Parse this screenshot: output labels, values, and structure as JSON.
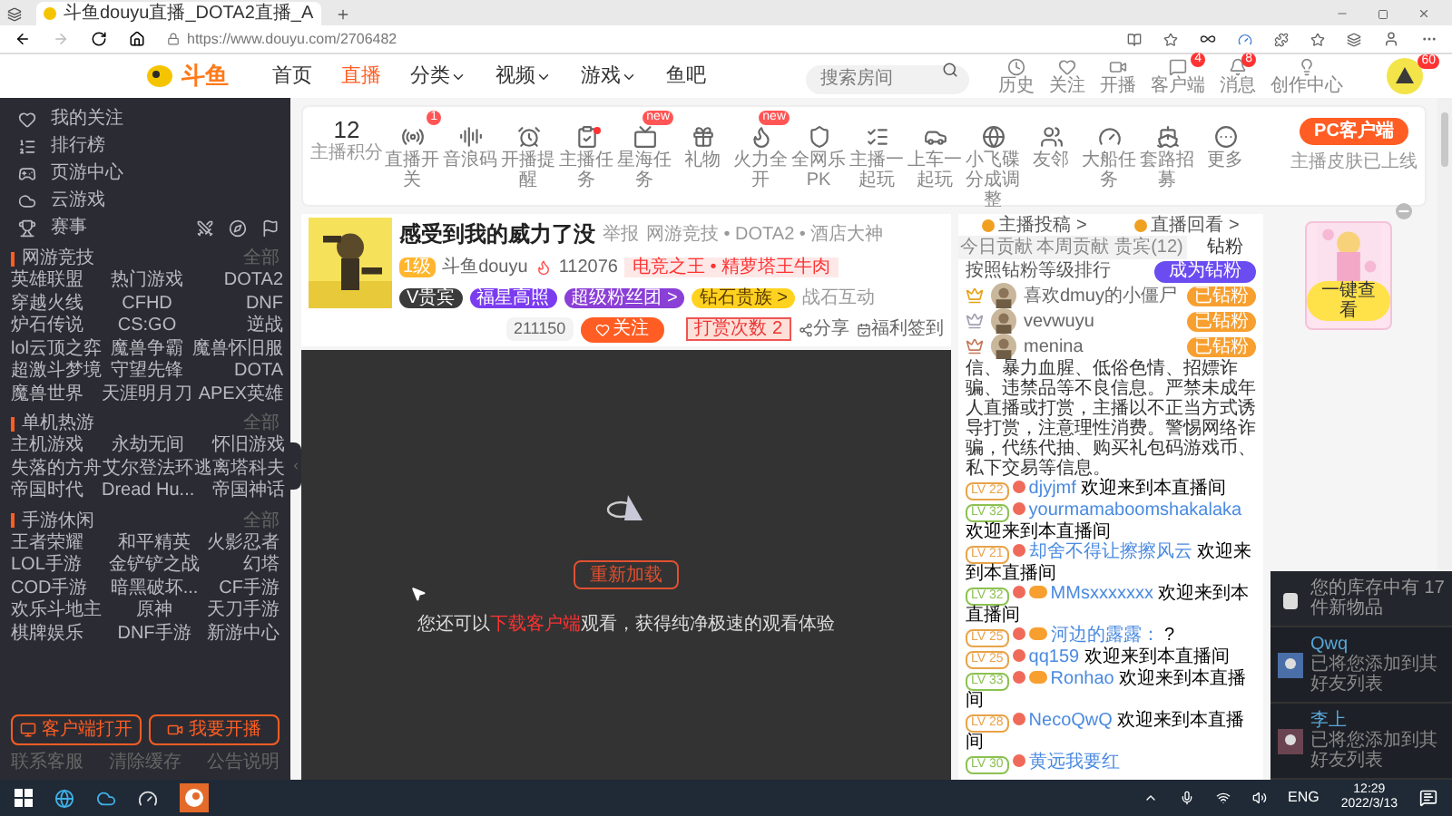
{
  "browser": {
    "tab_title": "斗鱼douyu直播_DOTA2直播_A",
    "url": "https://www.douyu.com/2706482"
  },
  "header": {
    "logo": "斗鱼",
    "nav": [
      {
        "label": "首页",
        "selected": false,
        "dropdown": false
      },
      {
        "label": "直播",
        "selected": true,
        "dropdown": false
      },
      {
        "label": "分类",
        "selected": false,
        "dropdown": true
      },
      {
        "label": "视频",
        "selected": false,
        "dropdown": true
      },
      {
        "label": "游戏",
        "selected": false,
        "dropdown": true
      },
      {
        "label": "鱼吧",
        "selected": false,
        "dropdown": false
      }
    ],
    "search": {
      "placeholder": "搜索房间"
    },
    "actions": [
      {
        "label": "历史"
      },
      {
        "label": "关注"
      },
      {
        "label": "开播"
      },
      {
        "label": "客户端",
        "badge": "4"
      },
      {
        "label": "消息",
        "badge": "8"
      },
      {
        "label": "创作中心"
      }
    ],
    "avatar_badge": "60"
  },
  "sidebar": {
    "items": [
      {
        "label": "我的关注"
      },
      {
        "label": "排行榜"
      },
      {
        "label": "页游中心"
      },
      {
        "label": "云游戏"
      }
    ],
    "events_label": "赛事",
    "sections": [
      {
        "title": "网游竞技",
        "more": "全部",
        "games": [
          "英雄联盟",
          "热门游戏",
          "DOTA2",
          "穿越火线",
          "CFHD",
          "DNF",
          "炉石传说",
          "CS:GO",
          "逆战",
          "lol云顶之弈",
          "魔兽争霸",
          "魔兽怀旧服",
          "超激斗梦境",
          "守望先锋",
          "DOTA",
          "魔兽世界",
          "天涯明月刀",
          "APEX英雄"
        ]
      },
      {
        "title": "单机热游",
        "more": "全部",
        "games": [
          "主机游戏",
          "永劫无间",
          "怀旧游戏",
          "失落的方舟",
          "艾尔登法环",
          "逃离塔科夫",
          "帝国时代",
          "Dread Hu...",
          "帝国神话"
        ]
      },
      {
        "title": "手游休闲",
        "more": "全部",
        "games": [
          "王者荣耀",
          "和平精英",
          "火影忍者",
          "LOL手游",
          "金铲铲之战",
          "幻塔",
          "COD手游",
          "暗黑破坏...",
          "CF手游",
          "欢乐斗地主",
          "原神",
          "天刀手游",
          "棋牌娱乐",
          "DNF手游",
          "新游中心"
        ]
      }
    ],
    "buttons": [
      "客户端打开",
      "我要开播"
    ],
    "footer": [
      "联系客服",
      "清除缓存",
      "公告说明"
    ]
  },
  "toolbar": {
    "score": "12",
    "score_label": "主播积分",
    "items": [
      {
        "label": "直播开关",
        "badge": "1",
        "dot": false
      },
      {
        "label": "音浪码",
        "dot": false
      },
      {
        "label": "开播提醒",
        "dot": false
      },
      {
        "label": "主播任务",
        "dot": true
      },
      {
        "label": "星海任务",
        "badge": "new",
        "dot": false
      },
      {
        "label": "礼物",
        "dot": false
      },
      {
        "label": "火力全开",
        "badge": "new",
        "dot": false
      },
      {
        "label": "全网乐PK",
        "dot": false
      },
      {
        "label": "主播一起玩",
        "dot": false
      },
      {
        "label": "上车一起玩",
        "dot": false
      },
      {
        "label": "小飞碟分成调整",
        "dot": false
      },
      {
        "label": "友邻",
        "dot": false
      },
      {
        "label": "大船任务",
        "dot": false
      },
      {
        "label": "套路招募",
        "dot": false
      },
      {
        "label": "更多",
        "dot": false
      }
    ],
    "pc_button": "PC客户端",
    "pc_note": "主播皮肤已上线"
  },
  "room": {
    "title": "感受到我的威力了没",
    "report": "举报",
    "category": "网游竞技 • DOTA2 • 酒店大神",
    "level": "1级",
    "anchor": "斗鱼douyu",
    "heat": "112076",
    "honor": "电竞之王 • 精萝塔王牛肉",
    "group": "战石互动",
    "tags": [
      {
        "label": "V贵宾",
        "kind": "dark"
      },
      {
        "label": "福星高照",
        "kind": "purple"
      },
      {
        "label": "超级粉丝团 >",
        "kind": "violet"
      },
      {
        "label": "钻石贵族 >",
        "kind": "yellow"
      }
    ],
    "followers": "211150",
    "follow": "关注",
    "reward": "打赏次数",
    "reward_count": "2",
    "share": "分享",
    "sign": "福利签到"
  },
  "player": {
    "reload": "重新加载",
    "tip": "您还可以**下载客户端**观看，获得纯净极速的观看体验"
  },
  "panel": {
    "links": [
      "主播投稿 >",
      "直播回看 >"
    ],
    "tabs": [
      {
        "label": "今日贡献",
        "selected": false
      },
      {
        "label": "本周贡献",
        "selected": false
      },
      {
        "label": "贵宾(12)",
        "selected": false
      },
      {
        "label": "钻粉",
        "selected": true
      }
    ],
    "rank_title": "按照钻粉等级排行",
    "rank_button": "成为钻粉",
    "ranks": [
      {
        "name": "喜欢dmuy的小僵尸",
        "badge": "已钻粉",
        "color": "#e6a317"
      },
      {
        "name": "vevwuyu",
        "badge": "已钻粉",
        "color": "#a0a0b0"
      },
      {
        "name": "menina",
        "badge": "已钻粉",
        "color": "#c47a5a"
      }
    ],
    "notice": "信、暴力血腥、低俗色情、招嫖诈骗、违禁品等不良信息。严禁未成年人直播或打赏，主播以不正当方式诱导打赏，注意理性消费。警惕网络诈骗，代练代抽、购买礼包码游戏币、私下交易等信息。",
    "chat": [
      {
        "level": "LV 22",
        "color": "#e8a34a",
        "medal": false,
        "name": "djyjmf",
        "text": "欢迎来到本直播间"
      },
      {
        "level": "LV 32",
        "color": "#8cc152",
        "medal": false,
        "name": "yourmamaboomshakalaka",
        "text": "欢迎来到本直播间"
      },
      {
        "level": "LV 21",
        "color": "#e8a34a",
        "medal": false,
        "name": "却舍不得让擦擦风云",
        "text": "欢迎来到本直播间"
      },
      {
        "level": "LV 32",
        "color": "#8cc152",
        "medal": true,
        "name": "MMsxxxxxxx",
        "text": "欢迎来到本直播间"
      },
      {
        "level": "LV 25",
        "color": "#e8a34a",
        "medal": true,
        "name": "河边的露露：",
        "text": "?"
      },
      {
        "level": "LV 25",
        "color": "#e8a34a",
        "medal": false,
        "name": "qq159",
        "text": "欢迎来到本直播间"
      },
      {
        "level": "LV 33",
        "color": "#8cc152",
        "medal": true,
        "name": "Ronhao",
        "text": "欢迎来到本直播间"
      },
      {
        "level": "LV 28",
        "color": "#e8a34a",
        "medal": false,
        "name": "NecoQwQ",
        "text": "欢迎来到本直播间"
      },
      {
        "level": "LV 30",
        "color": "#8cc152",
        "medal": false,
        "name": "黄远我要红"
      }
    ]
  },
  "promo": {
    "button": "一键查看"
  },
  "notification": {
    "inventory": "您的库存中有 17 件新物品",
    "friends": [
      {
        "name": "Qwq",
        "line1": "已将您添加到其",
        "line2": "好友列表"
      },
      {
        "name": "李上",
        "line1": "已将您添加到其",
        "line2": "好友列表"
      }
    ]
  },
  "taskbar": {
    "lang": "ENG",
    "time": "12:29",
    "date": "2022/3/13"
  }
}
